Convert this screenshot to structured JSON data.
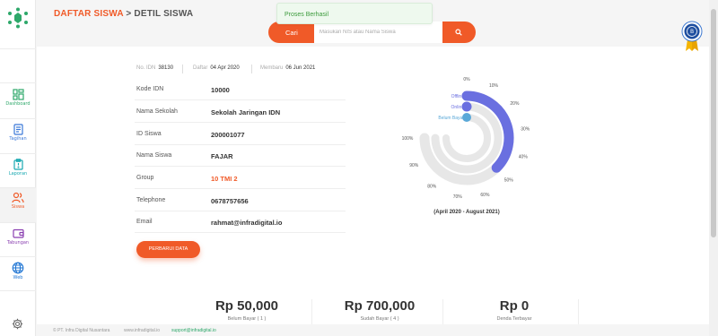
{
  "sidebar": {
    "items": [
      {
        "label": "Dashboard",
        "icon": "dashboard-icon",
        "color": "#2ea86a"
      },
      {
        "label": "Tagihan",
        "icon": "document-icon",
        "color": "#3a78d8"
      },
      {
        "label": "Laporan",
        "icon": "clipboard-icon",
        "color": "#17a8b0"
      },
      {
        "label": "Siswa",
        "icon": "users-icon",
        "color": "#f05a28"
      },
      {
        "label": "Tabungan",
        "icon": "wallet-icon",
        "color": "#8a3fb0"
      },
      {
        "label": "Web",
        "icon": "globe-icon",
        "color": "#2478d4"
      }
    ],
    "active": "Siswa"
  },
  "header": {
    "crumb": "DAFTAR SISWA",
    "separator": ">",
    "title": "DETIL SISWA"
  },
  "toast": {
    "message": "Proses Berhasil"
  },
  "search": {
    "button_label": "Cari",
    "placeholder": "Masukan NIS atau Nama Siswa"
  },
  "meta": {
    "no_idn_label": "No. IDN",
    "no_idn_value": "38130",
    "daftar_label": "Daftar",
    "daftar_value": "04 Apr 2020",
    "membaru_label": "Membaru",
    "membaru_value": "06 Jun 2021"
  },
  "details": [
    {
      "label": "Kode IDN",
      "value": "10000"
    },
    {
      "label": "Nama Sekolah",
      "value": "Sekolah Jaringan IDN"
    },
    {
      "label": "ID Siswa",
      "value": "200001077"
    },
    {
      "label": "Nama Siswa",
      "value": "FAJAR"
    },
    {
      "label": "Group",
      "value": "10 TMI 2"
    },
    {
      "label": "Telephone",
      "value": "0678757656"
    },
    {
      "label": "Email",
      "value": "rahmat@infradigital.io"
    }
  ],
  "update_button": "PERBARUI DATA",
  "chart_data": {
    "type": "radial-bar",
    "ticks": [
      "0%",
      "10%",
      "20%",
      "30%",
      "40%",
      "50%",
      "60%",
      "70%",
      "80%",
      "90%",
      "100%"
    ],
    "series": [
      {
        "name": "Offline",
        "value": 50,
        "color": "#6a6fe0"
      },
      {
        "name": "Online",
        "value": 0,
        "color": "#6a6fe0"
      },
      {
        "name": "Belum Bayar",
        "value": 0,
        "color": "#5aa8d8"
      }
    ],
    "caption": "(April 2020 - August 2021)"
  },
  "summary": [
    {
      "amount": "Rp 50,000",
      "label": "Belum Bayar ( 1 )"
    },
    {
      "amount": "Rp 700,000",
      "label": "Sudah Bayar ( 4 )"
    },
    {
      "amount": "Rp 0",
      "label": "Denda Terbayar"
    }
  ],
  "footer": {
    "company": "© PT. Infra Digital Nusantara",
    "site": "www.infradigital.io",
    "email": "support@infradigital.io"
  }
}
